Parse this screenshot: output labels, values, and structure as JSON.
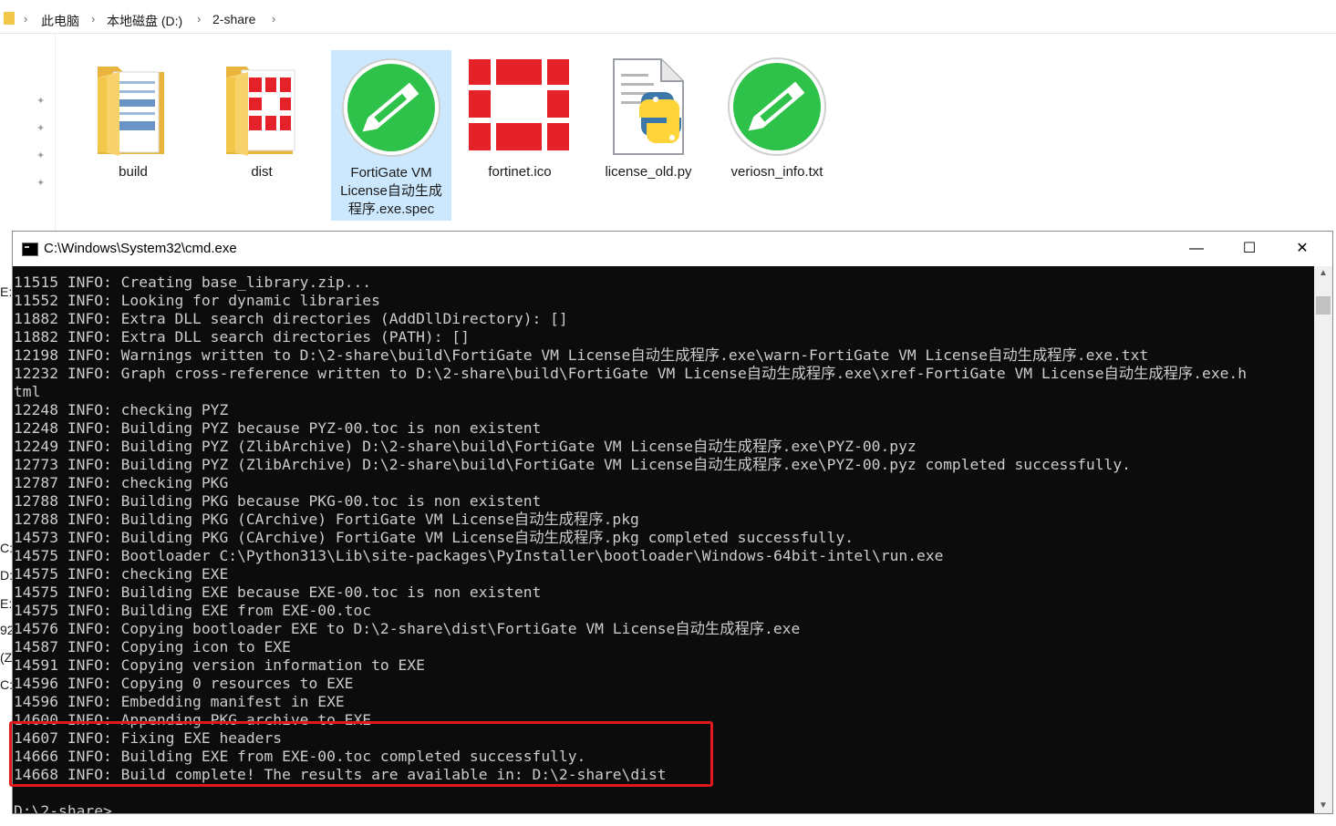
{
  "explorer": {
    "breadcrumb": [
      "此电脑",
      "本地磁盘 (D:)",
      "2-share"
    ],
    "items": [
      {
        "label": "build",
        "icon": "folder-icon"
      },
      {
        "label": "dist",
        "icon": "folder-fortinet-icon"
      },
      {
        "label_lines": [
          "FortiGate VM",
          "License自动生成",
          "程序.exe.spec"
        ],
        "icon": "edit-file-icon"
      },
      {
        "label": "fortinet.ico",
        "icon": "fortinet-icon"
      },
      {
        "label": "license_old.py",
        "icon": "python-file-icon"
      },
      {
        "label": "veriosn_info.txt",
        "icon": "edit-file-icon"
      }
    ],
    "left_fragments": [
      "E:)",
      "C:",
      "D:",
      "E:)",
      "92",
      "(Z:",
      "C:"
    ]
  },
  "cmd": {
    "title": "C:\\Windows\\System32\\cmd.exe",
    "lines": [
      "11515 INFO: Creating base_library.zip...",
      "11552 INFO: Looking for dynamic libraries",
      "11882 INFO: Extra DLL search directories (AddDllDirectory): []",
      "11882 INFO: Extra DLL search directories (PATH): []",
      "12198 INFO: Warnings written to D:\\2-share\\build\\FortiGate VM License自动生成程序.exe\\warn-FortiGate VM License自动生成程序.exe.txt",
      "12232 INFO: Graph cross-reference written to D:\\2-share\\build\\FortiGate VM License自动生成程序.exe\\xref-FortiGate VM License自动生成程序.exe.h",
      "tml",
      "12248 INFO: checking PYZ",
      "12248 INFO: Building PYZ because PYZ-00.toc is non existent",
      "12249 INFO: Building PYZ (ZlibArchive) D:\\2-share\\build\\FortiGate VM License自动生成程序.exe\\PYZ-00.pyz",
      "12773 INFO: Building PYZ (ZlibArchive) D:\\2-share\\build\\FortiGate VM License自动生成程序.exe\\PYZ-00.pyz completed successfully.",
      "12787 INFO: checking PKG",
      "12788 INFO: Building PKG because PKG-00.toc is non existent",
      "12788 INFO: Building PKG (CArchive) FortiGate VM License自动生成程序.pkg",
      "14573 INFO: Building PKG (CArchive) FortiGate VM License自动生成程序.pkg completed successfully.",
      "14575 INFO: Bootloader C:\\Python313\\Lib\\site-packages\\PyInstaller\\bootloader\\Windows-64bit-intel\\run.exe",
      "14575 INFO: checking EXE",
      "14575 INFO: Building EXE because EXE-00.toc is non existent",
      "14575 INFO: Building EXE from EXE-00.toc",
      "14576 INFO: Copying bootloader EXE to D:\\2-share\\dist\\FortiGate VM License自动生成程序.exe",
      "14587 INFO: Copying icon to EXE",
      "14591 INFO: Copying version information to EXE",
      "14596 INFO: Copying 0 resources to EXE",
      "14596 INFO: Embedding manifest in EXE",
      "14600 INFO: Appending PKG archive to EXE",
      "14607 INFO: Fixing EXE headers",
      "14666 INFO: Building EXE from EXE-00.toc completed successfully.",
      "14668 INFO: Build complete! The results are available in: D:\\2-share\\dist",
      "",
      "D:\\2-share>"
    ],
    "highlight_color": "#e0191c"
  }
}
